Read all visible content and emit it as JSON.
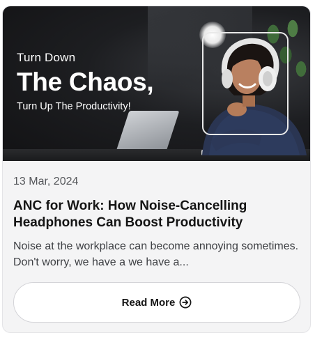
{
  "banner": {
    "line1": "Turn Down",
    "line2": "The Chaos,",
    "line3": "Turn Up The Productivity!"
  },
  "post": {
    "date": "13 Mar, 2024",
    "title": "ANC for Work: How Noise-Cancelling Headphones Can Boost Productivity",
    "excerpt": "Noise at the workplace can become annoying sometimes. Don't worry, we have a we have a..."
  },
  "cta": {
    "label": "Read More",
    "icon": "arrow-right-circle-icon"
  },
  "colors": {
    "card_bg": "#f4f4f5",
    "banner_bg": "#1d1e21",
    "button_bg": "#ffffff",
    "text_primary": "#141414"
  }
}
